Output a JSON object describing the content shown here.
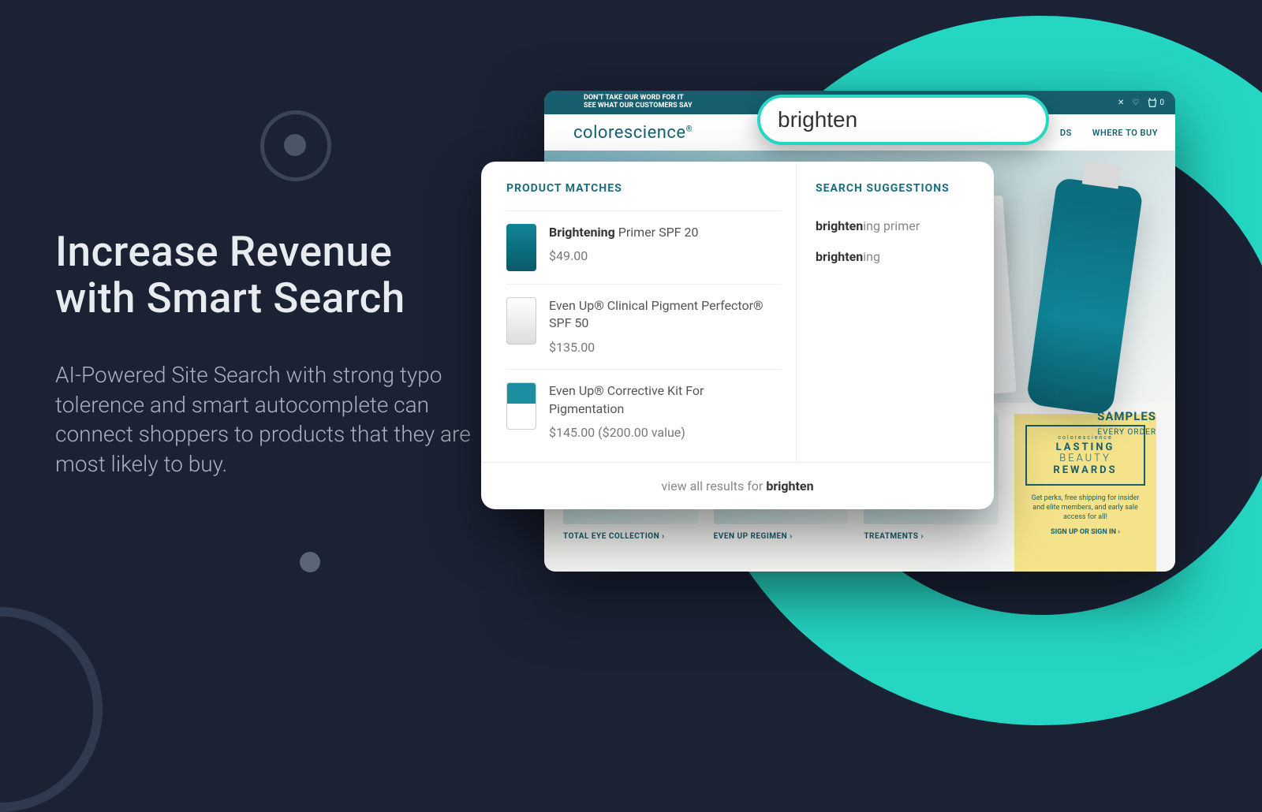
{
  "hero": {
    "title_line1": "Increase Revenue",
    "title_line2": "with Smart Search",
    "body": "AI-Powered Site Search with strong typo tolerence and smart autocomplete can connect shoppers to products that they are most likely to buy."
  },
  "topbar": {
    "line1": "DON'T TAKE OUR WORD FOR IT",
    "line2": "SEE WHAT OUR CUSTOMERS SAY",
    "cart_count": "0"
  },
  "brand": "colorescience",
  "nav": {
    "rewards": "DS",
    "where": "WHERE TO BUY"
  },
  "search": {
    "value": "brighten"
  },
  "dropdown": {
    "matches_header": "PRODUCT MATCHES",
    "suggestions_header": "SEARCH SUGGESTIONS",
    "products": [
      {
        "name_b": "Brightening",
        "name_rest": " Primer SPF 20",
        "price": "$49.00"
      },
      {
        "name_b": "",
        "name_rest": "Even Up® Clinical Pigment Perfector® SPF 50",
        "price": "$135.00"
      },
      {
        "name_b": "",
        "name_rest": "Even Up® Corrective Kit For Pigmentation",
        "price": "$145.00  ($200.00 value)"
      }
    ],
    "suggestions": [
      {
        "b": "brighten",
        "rest": "ing primer"
      },
      {
        "b": "brighten",
        "rest": "ing"
      }
    ],
    "footer_prefix": "view all results for ",
    "footer_term": "brighten"
  },
  "promo": {
    "samples": "SAMPLES",
    "samples_sub": "EVERY ORDER",
    "tiles": [
      {
        "label": "TOTAL EYE COLLECTION ›"
      },
      {
        "label": "EVEN UP REGIMEN ›"
      },
      {
        "label": "TREATMENTS ›"
      }
    ],
    "rewards": {
      "small": "colorescience",
      "l1": "LASTING",
      "l2": "BEAUTY",
      "l3": "REWARDS",
      "blurb": "Get perks, free shipping for insider and elite members, and early sale access for all!",
      "signin": "SIGN UP OR SIGN IN ›"
    }
  }
}
